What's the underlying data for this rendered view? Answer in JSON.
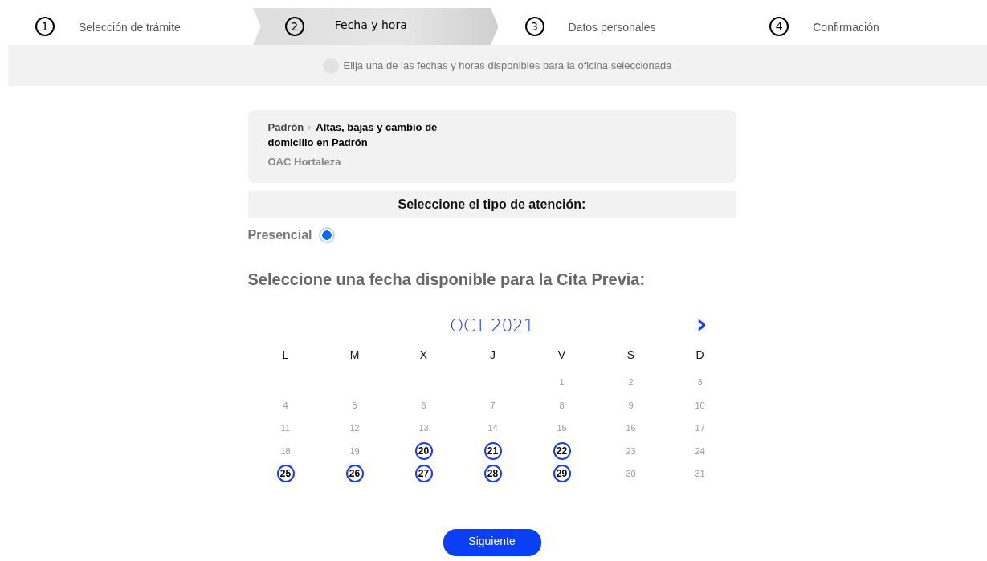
{
  "steps": [
    {
      "number": "1",
      "label": "Selección de trámite",
      "selected": false
    },
    {
      "number": "2",
      "label": "Fecha y hora",
      "selected": true
    },
    {
      "number": "3",
      "label": "Datos personales",
      "selected": false
    },
    {
      "number": "4",
      "label": "Confirmación",
      "selected": false
    }
  ],
  "info": "Elija una de las fechas y horas disponibles para la oficina seleccionada",
  "summary": {
    "category": "Padrón",
    "procedure": "Altas, bajas y cambio de domicilio en Padrón",
    "office": "OAC Hortaleza"
  },
  "attention": {
    "title": "Seleccione el tipo de atención:",
    "options": [
      {
        "label": "Presencial",
        "selected": true
      }
    ]
  },
  "calendar": {
    "title": "Seleccione una fecha disponible para la Cita Previa:",
    "month": "OCT 2021",
    "next": "›",
    "weekdays": [
      "L",
      "M",
      "X",
      "J",
      "V",
      "S",
      "D"
    ],
    "weeks": [
      [
        {
          "kind": "empty"
        },
        {
          "kind": "empty"
        },
        {
          "kind": "empty"
        },
        {
          "kind": "empty"
        },
        {
          "kind": "day",
          "day": "1",
          "available": false
        },
        {
          "kind": "day",
          "day": "2",
          "available": false
        },
        {
          "kind": "day",
          "day": "3",
          "available": false
        }
      ],
      [
        {
          "kind": "day",
          "day": "4",
          "available": false
        },
        {
          "kind": "day",
          "day": "5",
          "available": false
        },
        {
          "kind": "day",
          "day": "6",
          "available": false
        },
        {
          "kind": "day",
          "day": "7",
          "available": false
        },
        {
          "kind": "day",
          "day": "8",
          "available": false
        },
        {
          "kind": "day",
          "day": "9",
          "available": false
        },
        {
          "kind": "day",
          "day": "10",
          "available": false
        }
      ],
      [
        {
          "kind": "day",
          "day": "11",
          "available": false
        },
        {
          "kind": "day",
          "day": "12",
          "available": false
        },
        {
          "kind": "day",
          "day": "13",
          "available": false
        },
        {
          "kind": "day",
          "day": "14",
          "available": false
        },
        {
          "kind": "day",
          "day": "15",
          "available": false
        },
        {
          "kind": "day",
          "day": "16",
          "available": false
        },
        {
          "kind": "day",
          "day": "17",
          "available": false
        }
      ],
      [
        {
          "kind": "day",
          "day": "18",
          "available": false
        },
        {
          "kind": "day",
          "day": "19",
          "available": false
        },
        {
          "kind": "day",
          "day": "20",
          "available": true
        },
        {
          "kind": "day",
          "day": "21",
          "available": true
        },
        {
          "kind": "day",
          "day": "22",
          "available": true
        },
        {
          "kind": "day",
          "day": "23",
          "available": false
        },
        {
          "kind": "day",
          "day": "24",
          "available": false
        }
      ],
      [
        {
          "kind": "day",
          "day": "25",
          "available": true
        },
        {
          "kind": "day",
          "day": "26",
          "available": true
        },
        {
          "kind": "day",
          "day": "27",
          "available": true
        },
        {
          "kind": "day",
          "day": "28",
          "available": true
        },
        {
          "kind": "day",
          "day": "29",
          "available": true
        },
        {
          "kind": "day",
          "day": "30",
          "available": false
        },
        {
          "kind": "day",
          "day": "31",
          "available": false
        }
      ]
    ]
  },
  "next_button": "Siguiente"
}
